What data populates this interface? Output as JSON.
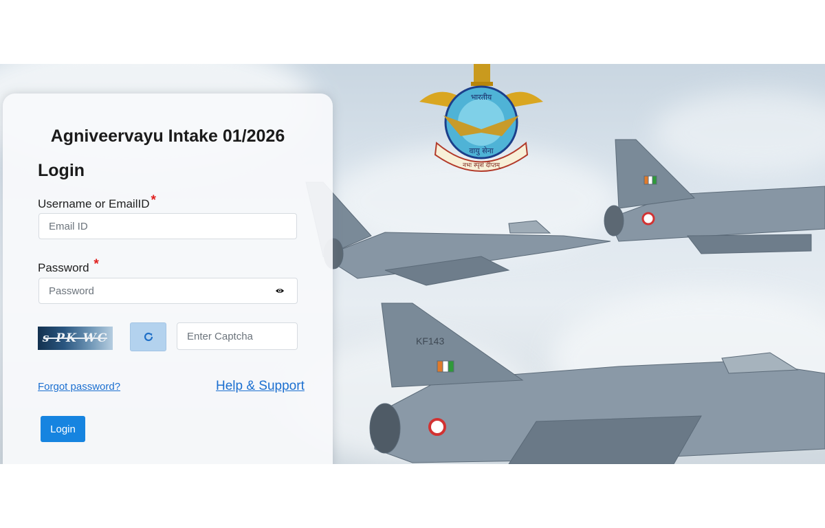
{
  "page": {
    "title": "Agniveervayu Intake 01/2026",
    "heading": "Login"
  },
  "form": {
    "username_label": "Username or EmailID",
    "username_required": "*",
    "username_placeholder": "Email ID",
    "username_value": "",
    "password_label": "Password",
    "password_required": "*",
    "password_placeholder": "Password",
    "password_value": "",
    "captcha_text": "s PK WC",
    "captcha_placeholder": "Enter Captcha",
    "captcha_value": "",
    "forgot_link": "Forgot password?",
    "help_link": "Help & Support",
    "login_button": "Login"
  },
  "emblem": {
    "text_top": "भारतीय",
    "text_middle": "वायु सेना",
    "motto": "नभः स्पृशं दीप्तम्"
  },
  "aircraft": {
    "tail_marking": "KF143"
  },
  "colors": {
    "accent": "#1684e0",
    "link": "#1b6fd0",
    "required": "#e0201e",
    "refresh_button": "#b3d2ee"
  },
  "icons": {
    "password_toggle": "eye-icon",
    "captcha_refresh": "refresh-icon"
  }
}
